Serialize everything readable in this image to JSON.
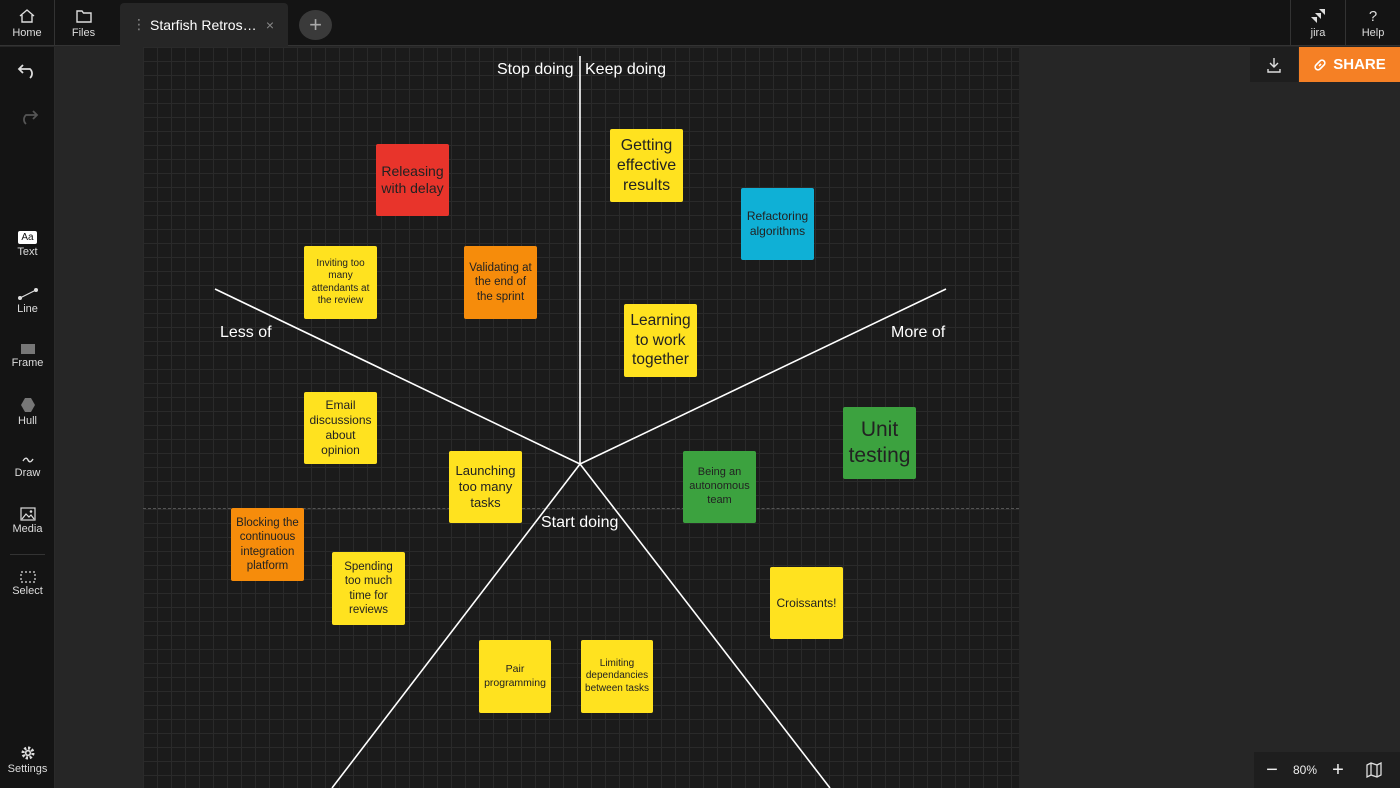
{
  "topbar": {
    "home_label": "Home",
    "files_label": "Files",
    "tab_title": "Starfish Retros…",
    "tab_close": "×",
    "add_tab": "+",
    "jira_label": "jira",
    "help_icon": "?",
    "help_label": "Help"
  },
  "tools": {
    "text_icon": "Aa",
    "text": "Text",
    "line": "Line",
    "frame": "Frame",
    "hull": "Hull",
    "draw": "Draw",
    "media": "Media",
    "select": "Select",
    "settings": "Settings"
  },
  "labels": {
    "stop_doing": "Stop doing",
    "keep_doing": "Keep doing",
    "less_of": "Less of",
    "more_of": "More of",
    "start_doing": "Start doing"
  },
  "notes": {
    "releasing": "Releasing with delay",
    "getting_results": "Getting effective results",
    "refactoring": "Refactoring algorithms",
    "inviting": "Inviting too many attendants at the review",
    "validating": "Validating at the end of the sprint",
    "learning": "Learning to work together",
    "email": "Email discussions about opinion",
    "unit_testing": "Unit testing",
    "launching": "Launching too many tasks",
    "autonomous": "Being an autonomous team",
    "blocking": "Blocking the continuous integration platform",
    "spending": "Spending too much time for reviews",
    "croissants": "Croissants!",
    "pair": "Pair programming",
    "limiting": "Limiting dependancies between tasks"
  },
  "controls": {
    "share_label": "SHARE",
    "zoom_minus": "−",
    "zoom_level": "80%",
    "zoom_plus": "+"
  },
  "colors": {
    "yellow": "#ffe21f",
    "red": "#e8342b",
    "orange": "#f68c0b",
    "blue": "#0fb0d6",
    "green": "#3ca23f",
    "share": "#f58025"
  },
  "icons": [
    "home-icon",
    "folder-icon",
    "undo-icon",
    "redo-icon",
    "line-icon",
    "frame-icon",
    "hull-icon",
    "draw-icon",
    "media-icon",
    "select-icon",
    "gear-icon",
    "jira-icon",
    "download-icon",
    "link-icon",
    "map-icon"
  ]
}
